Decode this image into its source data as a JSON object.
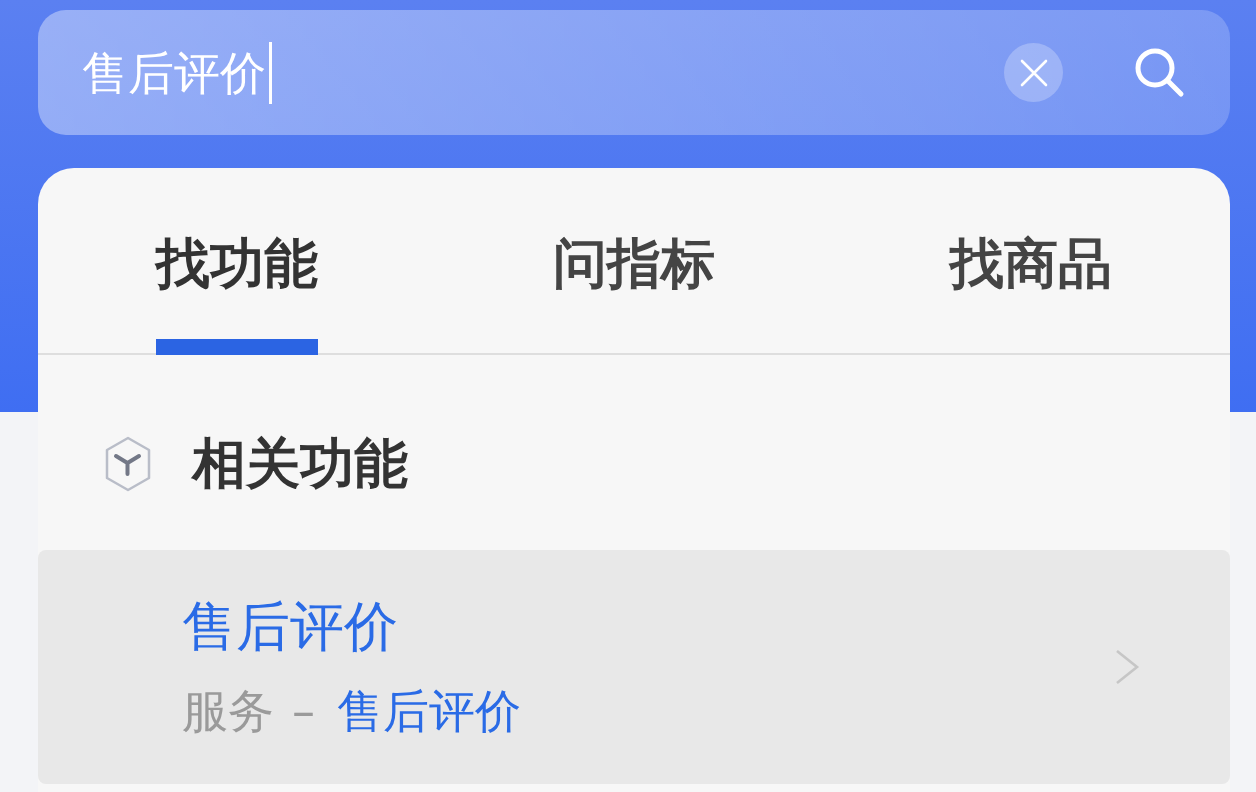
{
  "search": {
    "value": "售后评价",
    "focused": true
  },
  "tabs": [
    {
      "label": "找功能",
      "selected": true
    },
    {
      "label": "问指标",
      "selected": false
    },
    {
      "label": "找商品",
      "selected": false
    }
  ],
  "section": {
    "title": "相关功能"
  },
  "results": [
    {
      "title": "售后评价",
      "breadcrumb": {
        "category": "服务",
        "separator": "–",
        "current": "售后评价"
      },
      "selected": true
    }
  ]
}
